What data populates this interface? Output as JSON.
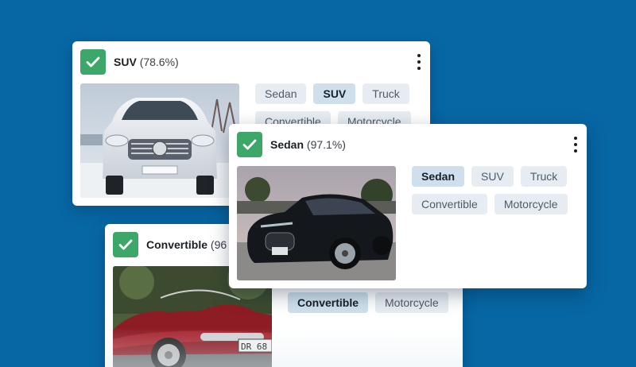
{
  "cards": {
    "suv": {
      "class_name": "SUV",
      "confidence": "(78.6%)",
      "image_alt": "White SUV in snow",
      "tags": [
        "Sedan",
        "SUV",
        "Truck",
        "Convertible",
        "Motorcycle"
      ],
      "selected_tag": "SUV"
    },
    "sedan": {
      "class_name": "Sedan",
      "confidence": "(97.1%)",
      "image_alt": "Black sedan on road",
      "tags": [
        "Sedan",
        "SUV",
        "Truck",
        "Convertible",
        "Motorcycle"
      ],
      "selected_tag": "Sedan"
    },
    "convertible": {
      "class_name": "Convertible",
      "confidence": "(96",
      "image_alt": "Red vintage convertible",
      "plate": "DR 68",
      "tags": [
        "Convertible",
        "Motorcycle"
      ],
      "selected_tag": "Convertible"
    }
  },
  "colors": {
    "background": "#0767a4",
    "check_green": "#3da76a",
    "tag_bg": "#e6ecf1",
    "tag_selected_bg": "#cfe0ec"
  },
  "icons": {
    "check": "checkmark-icon",
    "menu": "kebab-menu-icon"
  }
}
